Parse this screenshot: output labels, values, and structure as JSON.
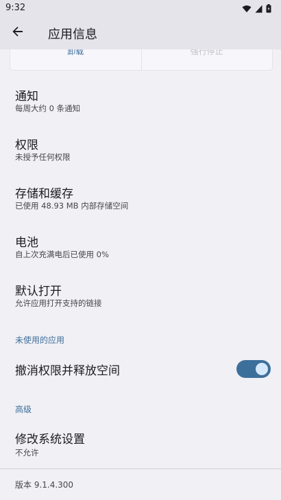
{
  "status_bar": {
    "time": "9:32",
    "icons": [
      "wifi-icon",
      "signal-icon",
      "battery-icon"
    ]
  },
  "app_bar": {
    "title": "应用信息",
    "back_icon": "arrow-back-icon"
  },
  "actions": {
    "uninstall": "卸载",
    "force_stop": "强行停止"
  },
  "items": [
    {
      "title": "通知",
      "subtitle": "每周大约 0 条通知"
    },
    {
      "title": "权限",
      "subtitle": "未授予任何权限"
    },
    {
      "title": "存储和缓存",
      "subtitle": "已使用 48.93 MB 内部存储空间"
    },
    {
      "title": "电池",
      "subtitle": "自上次充满电后已使用 0%"
    },
    {
      "title": "默认打开",
      "subtitle": "允许应用打开支持的链接"
    }
  ],
  "unused_apps": {
    "header": "未使用的应用",
    "toggle_label": "撤消权限并释放空间",
    "toggle_on": true
  },
  "advanced": {
    "header": "高级",
    "title": "修改系统设置",
    "subtitle": "不允许"
  },
  "footer": {
    "version": "版本 9.1.4.300"
  },
  "colors": {
    "accent": "#3d6f9b",
    "background": "#f1f0f5",
    "app_bar": "#e5e4ea"
  }
}
